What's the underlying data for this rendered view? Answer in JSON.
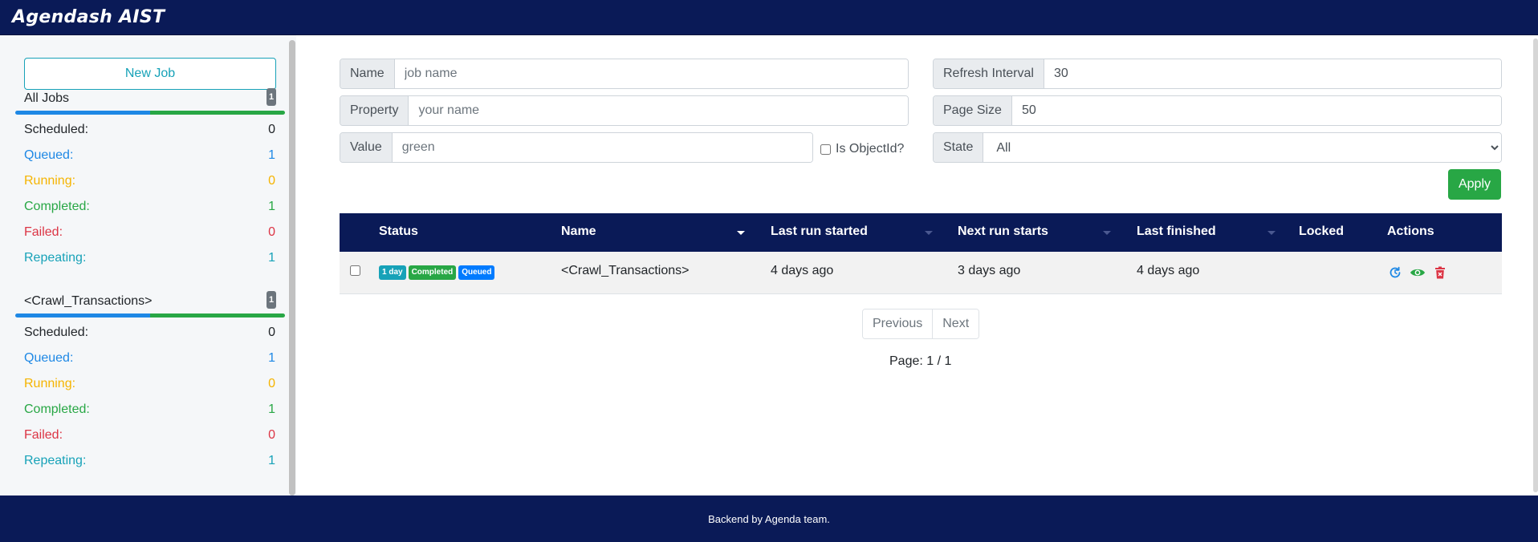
{
  "app": {
    "title": "Agendash AIST"
  },
  "sidebar": {
    "new_job_label": "New Job",
    "groups": [
      {
        "title": "All Jobs",
        "count": "1",
        "stats": [
          {
            "label": "Scheduled:",
            "value": "0"
          },
          {
            "label": "Queued:",
            "value": "1"
          },
          {
            "label": "Running:",
            "value": "0"
          },
          {
            "label": "Completed:",
            "value": "1"
          },
          {
            "label": "Failed:",
            "value": "0"
          },
          {
            "label": "Repeating:",
            "value": "1"
          }
        ]
      },
      {
        "title": "<Crawl_Transactions>",
        "count": "1",
        "stats": [
          {
            "label": "Scheduled:",
            "value": "0"
          },
          {
            "label": "Queued:",
            "value": "1"
          },
          {
            "label": "Running:",
            "value": "0"
          },
          {
            "label": "Completed:",
            "value": "1"
          },
          {
            "label": "Failed:",
            "value": "0"
          },
          {
            "label": "Repeating:",
            "value": "1"
          }
        ]
      }
    ]
  },
  "filters": {
    "name": {
      "label": "Name",
      "placeholder": "job name"
    },
    "property": {
      "label": "Property",
      "placeholder": "your name"
    },
    "value": {
      "label": "Value",
      "placeholder": "green"
    },
    "is_objectid_label": "Is ObjectId?",
    "refresh": {
      "label": "Refresh Interval",
      "value": "30"
    },
    "page_size": {
      "label": "Page Size",
      "value": "50"
    },
    "state": {
      "label": "State",
      "selected": "All"
    },
    "apply_label": "Apply"
  },
  "table": {
    "headers": {
      "status": "Status",
      "name": "Name",
      "last_run_started": "Last run started",
      "next_run_starts": "Next run starts",
      "last_finished": "Last finished",
      "locked": "Locked",
      "actions": "Actions"
    },
    "rows": [
      {
        "badges": [
          "1 day",
          "Completed",
          "Queued"
        ],
        "name": "<Crawl_Transactions>",
        "last_run_started": "4 days ago",
        "next_run_starts": "3 days ago",
        "last_finished": "4 days ago",
        "locked": ""
      }
    ]
  },
  "pagination": {
    "previous": "Previous",
    "next": "Next",
    "page_info": "Page: 1 / 1"
  },
  "footer": {
    "text": "Backend by Agenda team."
  },
  "colors": {
    "navy": "#0a1a57",
    "teal": "#17a2b8",
    "green": "#28a745",
    "blue": "#007bff",
    "red": "#dc3545",
    "yellow": "#f5b400"
  },
  "icons": {
    "requeue": "refresh-icon",
    "view": "eye-icon",
    "delete": "trash-icon"
  }
}
